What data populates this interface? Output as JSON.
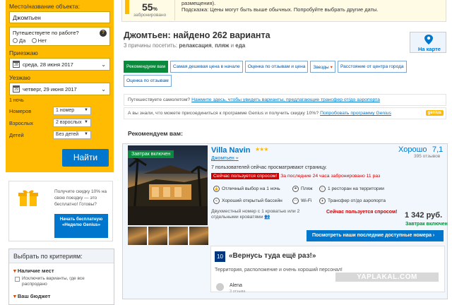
{
  "search": {
    "destination_label": "Место/название объекта:",
    "destination_value": "Джомтьен",
    "work_question": "Путешествуете по работе?",
    "work_yes": "Да",
    "work_no": "Нет",
    "checkin_label": "Приезжаю",
    "checkin_value": "среда, 28 июня 2017",
    "checkout_label": "Уезжаю",
    "checkout_value": "четверг, 29 июня 2017",
    "nights": "1 ночь",
    "rooms_label": "Номеров",
    "rooms_value": "1 номер",
    "adults_label": "Взрослых",
    "adults_value": "2 взрослых",
    "children_label": "Детей",
    "children_value": "Без детей",
    "submit": "Найти"
  },
  "genius": {
    "text": "Получите скидку 10% на свою поездку — это бесплатно! Готовы?",
    "button": "Начать бесплатную «Неделю Genius»"
  },
  "filters": {
    "title": "Выбрать по критериям:",
    "group1": "Наличие мест",
    "option1": "Исключить варианты, где все распродано",
    "group2": "Ваш бюджет"
  },
  "promo": {
    "percent": "55",
    "percent_unit": "%",
    "booked": "забронировано",
    "line1": "размещения).",
    "line2": "Подсказка: Цены могут быть выше обычных. Попробуйте выбрать другие даты."
  },
  "results": {
    "title": "Джомтьен: найдено 262 варианта",
    "reasons_prefix": "3 причины посетить:",
    "reason1": "релаксация",
    "reason2": "пляж",
    "reason_and": "и",
    "reason3": "еда",
    "map_label": "На карте"
  },
  "sort_tabs": [
    "Рекомендуем вам",
    "Самая дешевая цена в начале",
    "Оценка по отзывам и цена",
    "Звезды",
    "Расстояние от центра города",
    "Оценка по отзывам"
  ],
  "notes": {
    "plane_prefix": "Путешествуете самолетом?",
    "plane_link": "Нажмите здесь, чтобы увидеть варианты, предлагающие трансфер от/до аэропорта",
    "genius_prefix": "А вы знали, что можете присоединиться к программе Genius и получить скидку 10%?",
    "genius_link": "Попробовать программу Genius",
    "genius_badge": "genius"
  },
  "recommend_heading": "Рекомендуем вам:",
  "hotel": {
    "badge": "Завтрак включен",
    "name": "Villa Navin",
    "stars": "★★★",
    "city": "Джомтьен",
    "score_word": "Хорошо",
    "score": "7,1",
    "reviews_count": "395 отзывов",
    "viewers": "7 пользователей сейчас просматривают страницу.",
    "demand_badge": "Сейчас пользуется спросом!",
    "demand_text": "За последние 24 часа забронировано 11 раз",
    "features": [
      "Отличный выбор на 1 ночь",
      "Пляж",
      "1 ресторан на территории",
      "Хороший открытый бассейн",
      "Wi-Fi",
      "Трансфер от/до аэропорта"
    ],
    "room": "Двухместный номер с 1 кроватью или 2 отдельными кроватями",
    "demand_again": "Сейчас пользуется спросом!",
    "price": "1 342 руб.",
    "breakfast": "Завтрак включен",
    "cta": "Посмотреть наши последние доступные номера ›"
  },
  "review": {
    "score": "10",
    "title": "«Вернусь туда ещё раз!»",
    "text": "Территория, расположение и очень хороший персонал!",
    "author": "Alena",
    "author_count": "3 отзыва"
  },
  "watermark": "YAPLAKAL.COM"
}
